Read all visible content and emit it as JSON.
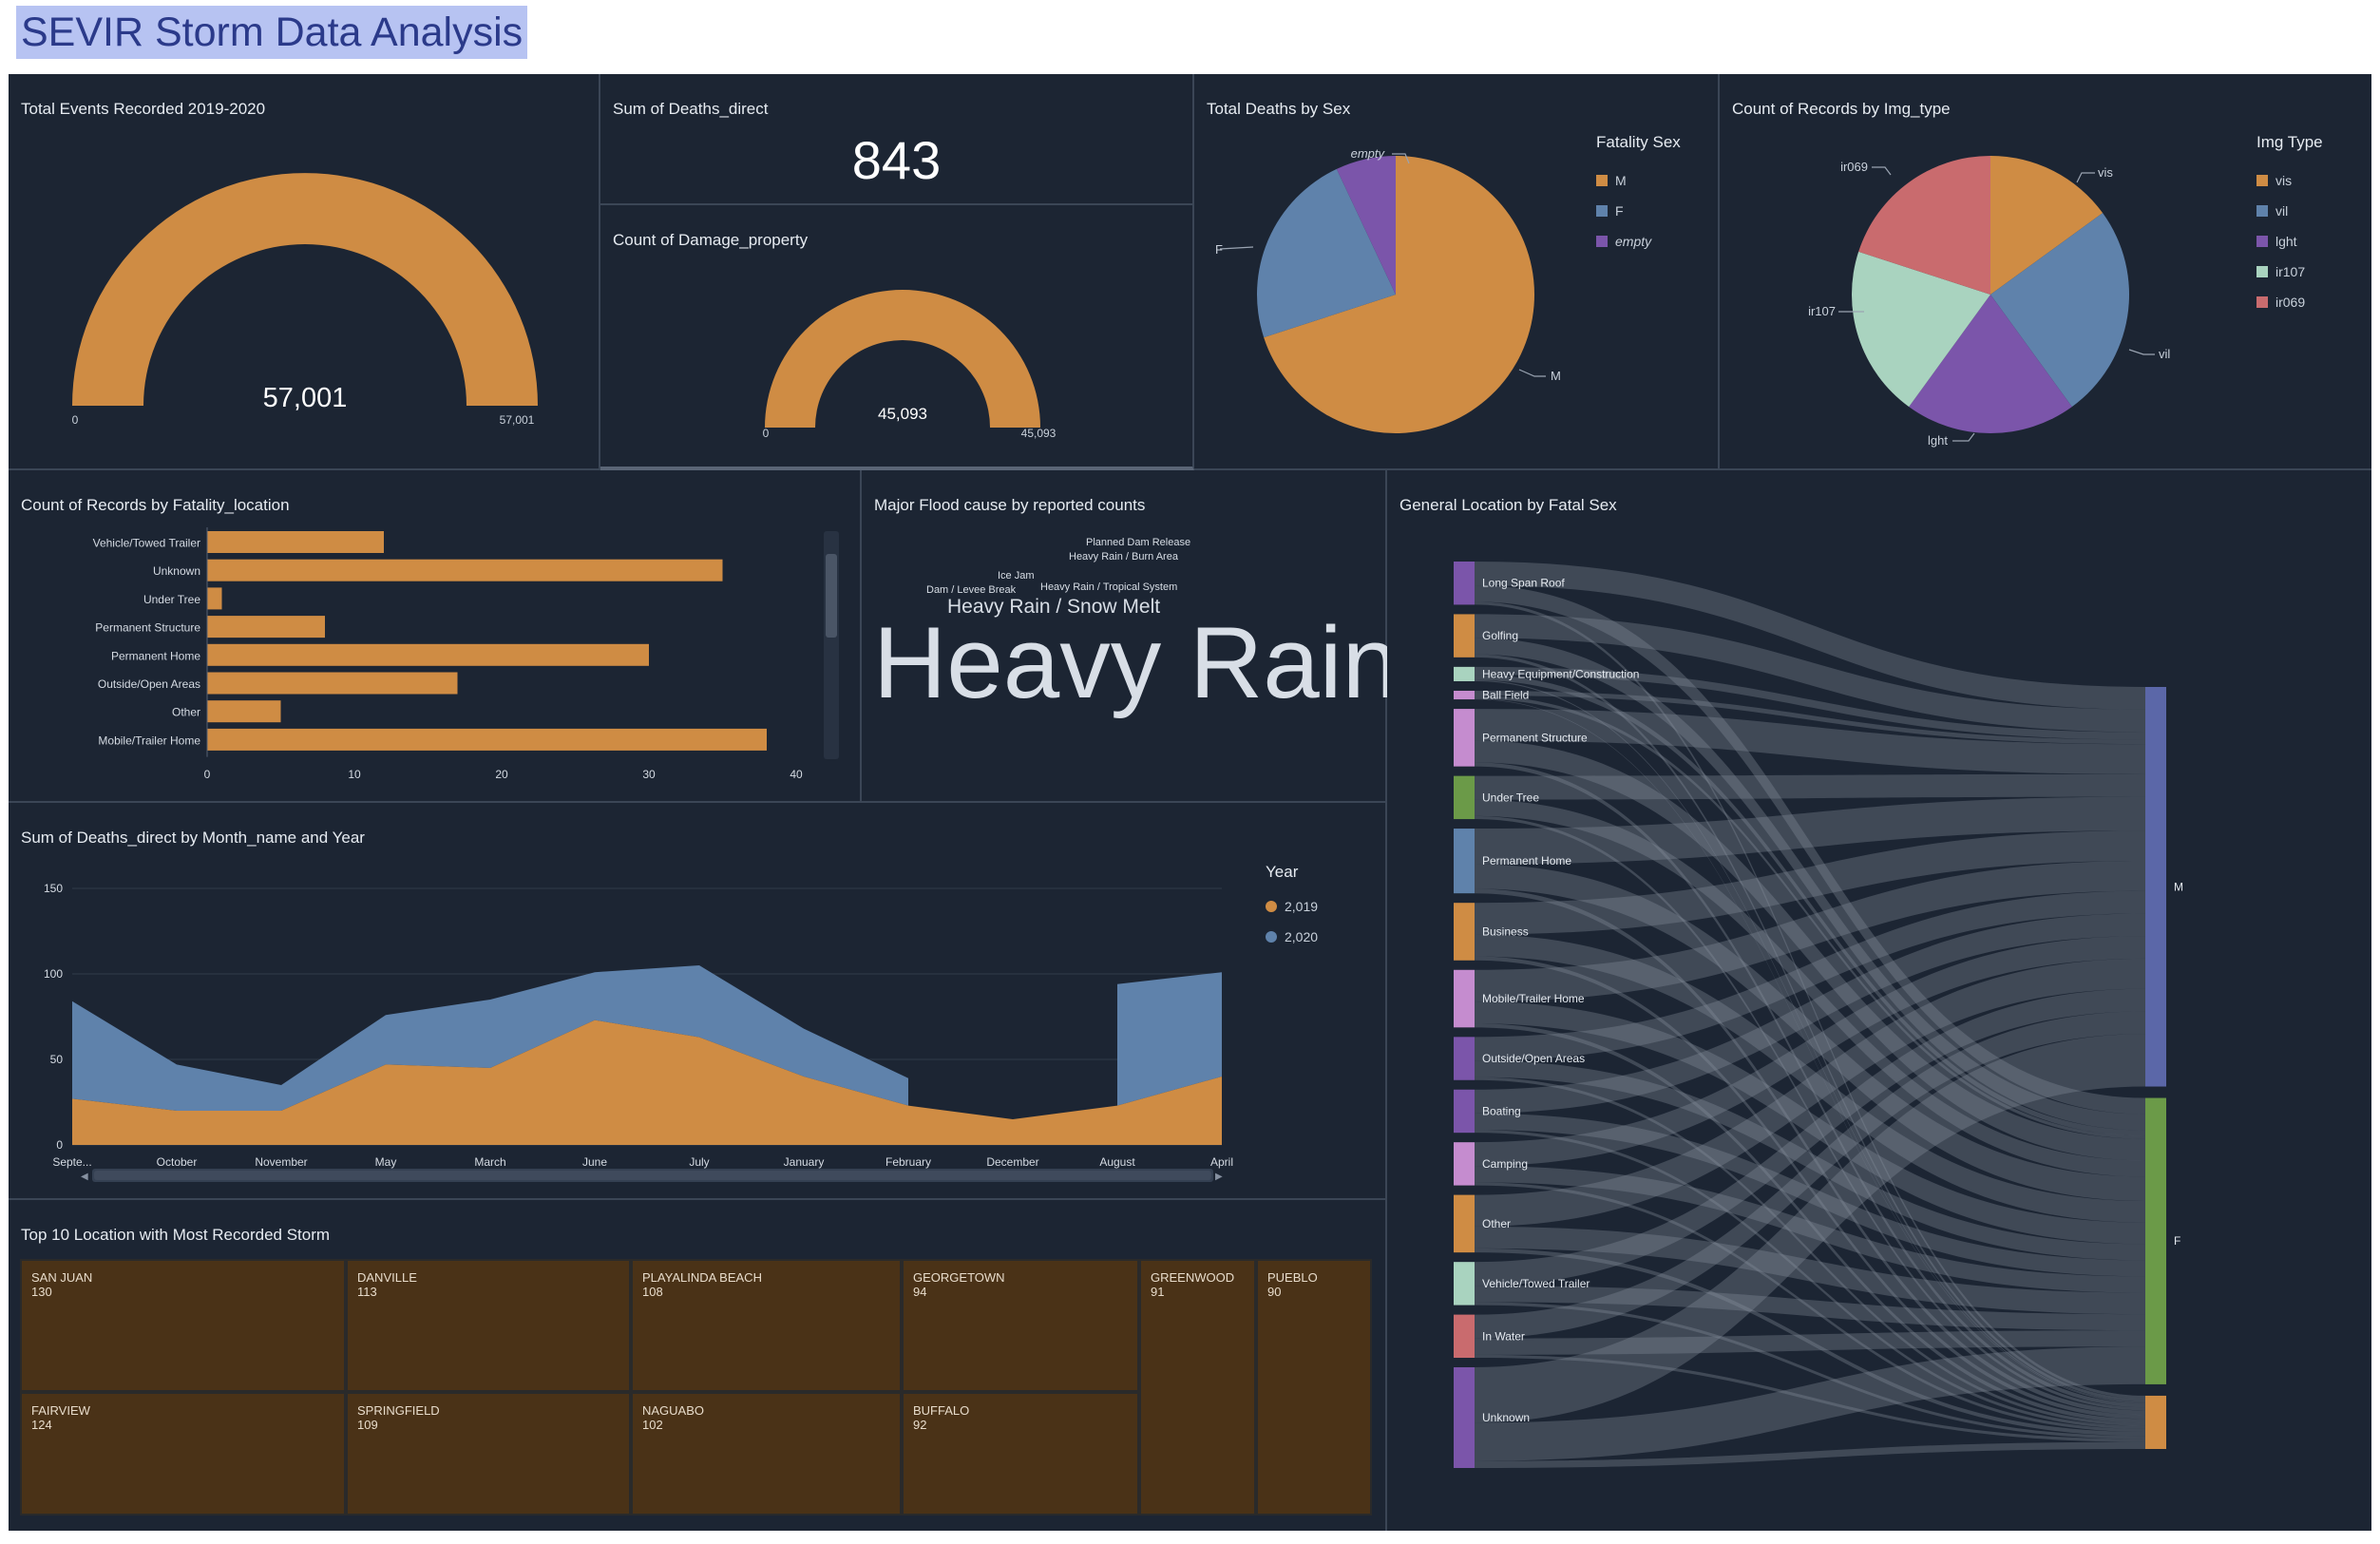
{
  "page_title": "SEVIR Storm Data Analysis",
  "colors": {
    "orange": "#cf8c44",
    "blue": "#5f82ab",
    "purple": "#7b55aa",
    "mint": "#a9d3bf",
    "red": "#c96b6e",
    "pink": "#c58ccf",
    "green": "#6b9a48",
    "indigo": "#5b67a8",
    "bg": "#1c2533"
  },
  "total_events": {
    "title": "Total Events Recorded 2019-2020",
    "value": "57,001",
    "min": "0",
    "max": "57,001",
    "fraction": 1.0
  },
  "deaths_direct": {
    "title": "Sum of Deaths_direct",
    "value": "843"
  },
  "damage_property": {
    "title": "Count of Damage_property",
    "value": "45,093",
    "min": "0",
    "max": "45,093",
    "fraction": 1.0
  },
  "deaths_by_sex": {
    "title": "Total Deaths by Sex",
    "legend_title": "Fatality Sex",
    "chart_data": {
      "type": "pie",
      "slices": [
        {
          "label": "M",
          "value": 70,
          "color": "#cf8c44"
        },
        {
          "label": "F",
          "value": 23,
          "color": "#5f82ab"
        },
        {
          "label": "empty",
          "value": 7,
          "color": "#7b55aa"
        }
      ]
    }
  },
  "img_type": {
    "title": "Count of Records by Img_type",
    "legend_title": "Img Type",
    "chart_data": {
      "type": "pie",
      "slices": [
        {
          "label": "vis",
          "value": 15,
          "color": "#cf8c44"
        },
        {
          "label": "vil",
          "value": 25,
          "color": "#5f82ab"
        },
        {
          "label": "lght",
          "value": 20,
          "color": "#7b55aa"
        },
        {
          "label": "ir107",
          "value": 20,
          "color": "#a9d3bf"
        },
        {
          "label": "ir069",
          "value": 20,
          "color": "#c96b6e"
        }
      ]
    }
  },
  "fatality_location": {
    "title": "Count of Records by Fatality_location",
    "chart_data": {
      "type": "bar",
      "orientation": "horizontal",
      "categories": [
        "Vehicle/Towed Trailer",
        "Unknown",
        "Under Tree",
        "Permanent Structure",
        "Permanent Home",
        "Outside/Open Areas",
        "Other",
        "Mobile/Trailer Home"
      ],
      "values": [
        12,
        35,
        1,
        8,
        30,
        17,
        5,
        38
      ],
      "xlim": [
        0,
        40
      ],
      "xticks": [
        "0",
        "10",
        "20",
        "30",
        "40"
      ]
    }
  },
  "flood_cause": {
    "title": "Major Flood cause by reported counts",
    "words": [
      {
        "text": "Planned Dam Release",
        "size": 11
      },
      {
        "text": "Heavy Rain / Burn Area",
        "size": 11
      },
      {
        "text": "Ice Jam",
        "size": 11
      },
      {
        "text": "Dam / Levee Break",
        "size": 11
      },
      {
        "text": "Heavy Rain / Tropical System",
        "size": 11
      },
      {
        "text": "Heavy Rain / Snow Melt",
        "size": 21
      },
      {
        "text": "Heavy Rain",
        "size": 107
      }
    ]
  },
  "deaths_by_month": {
    "title": "Sum of Deaths_direct by Month_name and Year",
    "legend_title": "Year",
    "chart_data": {
      "type": "area",
      "categories": [
        "Septe...",
        "October",
        "November",
        "May",
        "March",
        "June",
        "July",
        "January",
        "February",
        "December",
        "August",
        "April"
      ],
      "series": [
        {
          "name": "2,019",
          "color": "#cf8c44",
          "values": [
            27,
            20,
            20,
            47,
            45,
            73,
            63,
            40,
            23,
            15,
            23,
            40
          ]
        },
        {
          "name": "2,020",
          "color": "#5f82ab",
          "values": [
            57,
            27,
            15,
            29,
            40,
            28,
            42,
            28,
            16,
            null,
            71,
            61
          ]
        }
      ],
      "ylim": [
        0,
        150
      ],
      "yticks": [
        "0",
        "50",
        "100",
        "150"
      ]
    }
  },
  "top10": {
    "title": "Top 10 Location with Most Recorded Storm",
    "chart_data": {
      "type": "treemap",
      "items": [
        {
          "name": "SAN JUAN",
          "value": 130
        },
        {
          "name": "FAIRVIEW",
          "value": 124
        },
        {
          "name": "DANVILLE",
          "value": 113
        },
        {
          "name": "SPRINGFIELD",
          "value": 109
        },
        {
          "name": "PLAYALINDA BEACH",
          "value": 108
        },
        {
          "name": "NAGUABO",
          "value": 102
        },
        {
          "name": "GEORGETOWN",
          "value": 94
        },
        {
          "name": "BUFFALO",
          "value": 92
        },
        {
          "name": "GREENWOOD",
          "value": 91
        },
        {
          "name": "PUEBLO",
          "value": 90
        }
      ]
    }
  },
  "sankey": {
    "title": "General Location by Fatal Sex",
    "chart_data": {
      "type": "sankey",
      "sources": [
        {
          "label": "Long Span Roof",
          "value": 3,
          "color": "#7b55aa"
        },
        {
          "label": "Golfing",
          "value": 3,
          "color": "#cf8c44"
        },
        {
          "label": "Heavy Equipment/Construction",
          "value": 1,
          "color": "#a9d3bf"
        },
        {
          "label": "Ball Field",
          "value": 0.6,
          "color": "#c58ccf"
        },
        {
          "label": "Permanent Structure",
          "value": 4,
          "color": "#c58ccf"
        },
        {
          "label": "Under Tree",
          "value": 3,
          "color": "#6b9a48"
        },
        {
          "label": "Permanent Home",
          "value": 4.5,
          "color": "#5f82ab"
        },
        {
          "label": "Business",
          "value": 4,
          "color": "#cf8c44"
        },
        {
          "label": "Mobile/Trailer Home",
          "value": 4,
          "color": "#c58ccf"
        },
        {
          "label": "Outside/Open Areas",
          "value": 3,
          "color": "#7b55aa"
        },
        {
          "label": "Boating",
          "value": 3,
          "color": "#7b55aa"
        },
        {
          "label": "Camping",
          "value": 3,
          "color": "#c58ccf"
        },
        {
          "label": "Other",
          "value": 4,
          "color": "#cf8c44"
        },
        {
          "label": "Vehicle/Towed Trailer",
          "value": 3,
          "color": "#a9d3bf"
        },
        {
          "label": "In Water",
          "value": 3,
          "color": "#c96b6e"
        },
        {
          "label": "Unknown",
          "value": 7,
          "color": "#7b55aa"
        }
      ],
      "targets": [
        {
          "label": "M",
          "value": 60,
          "color": "#5b67a8"
        },
        {
          "label": "F",
          "value": 43,
          "color": "#6b9a48"
        },
        {
          "label": "",
          "value": 8,
          "color": "#cf8c44"
        }
      ]
    }
  }
}
